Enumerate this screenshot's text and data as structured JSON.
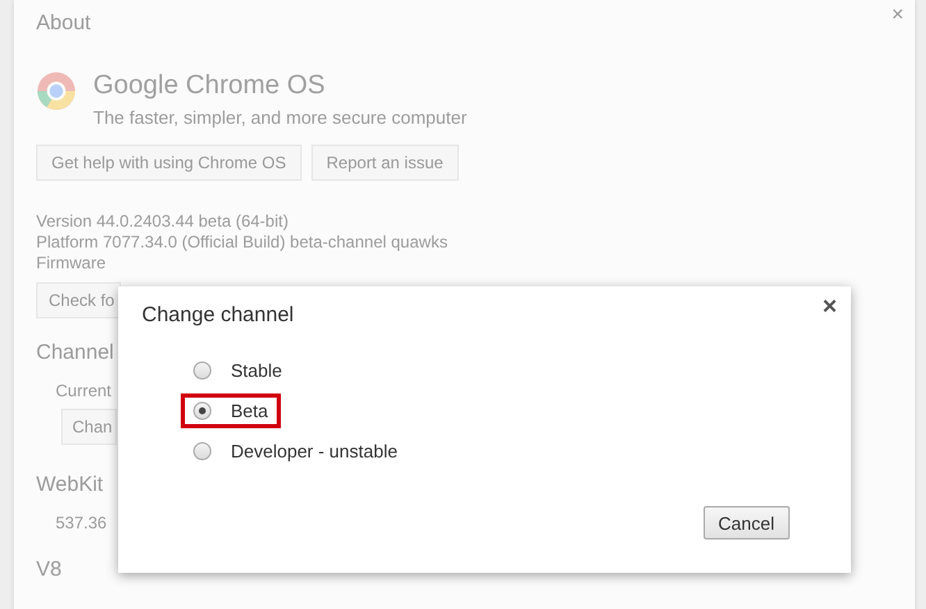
{
  "about": {
    "title": "About",
    "close": "×",
    "product": {
      "name": "Google Chrome OS",
      "tagline": "The faster, simpler, and more secure computer"
    },
    "buttons": [
      "Get help with using Chrome OS",
      "Report an issue"
    ],
    "version_lines": [
      "Version 44.0.2403.44 beta (64-bit)",
      "Platform 7077.34.0 (Official Build) beta-channel quawks",
      "Firmware"
    ],
    "check_button": "Check fo",
    "channel": {
      "heading": "Channel",
      "current": "Current",
      "change_button": "Chan"
    },
    "webkit": {
      "heading": "WebKit",
      "value": "537.36"
    },
    "v8": {
      "heading": "V8"
    }
  },
  "dialog": {
    "title": "Change channel",
    "close": "×",
    "options": [
      {
        "label": "Stable",
        "selected": false,
        "highlighted": false
      },
      {
        "label": "Beta",
        "selected": true,
        "highlighted": true
      },
      {
        "label": "Developer - unstable",
        "selected": false,
        "highlighted": false
      }
    ],
    "buttons": [
      "Cancel"
    ]
  }
}
